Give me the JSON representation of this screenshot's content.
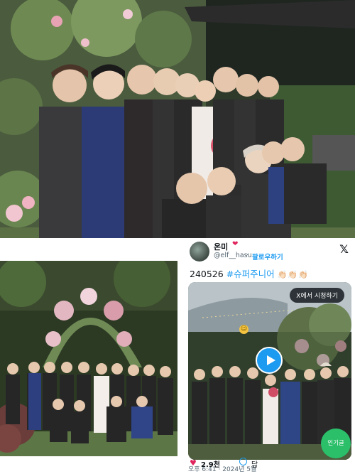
{
  "tweet": {
    "user_name": "온미",
    "user_handle": "@elf__hasu",
    "dot": "·",
    "follow_label": "팔로우하기",
    "text_date": "240526",
    "hashtag": "#슈퍼주니어",
    "hands": "👏🏻👏🏻👏🏻",
    "watch_label": "X에서 시청하기",
    "time_text": "오후 6:41 · 2024년 5월",
    "likes": "2.9천",
    "reply_label": "답"
  },
  "overlay": {
    "popular_label": "인기글"
  },
  "colors": {
    "link": "#1d9bf0",
    "like": "#e0245e",
    "popular": "#2bbf6a"
  },
  "icons": [
    "x-logo-icon",
    "play-icon",
    "heart-icon",
    "reply-icon",
    "smile-emoji-icon"
  ]
}
